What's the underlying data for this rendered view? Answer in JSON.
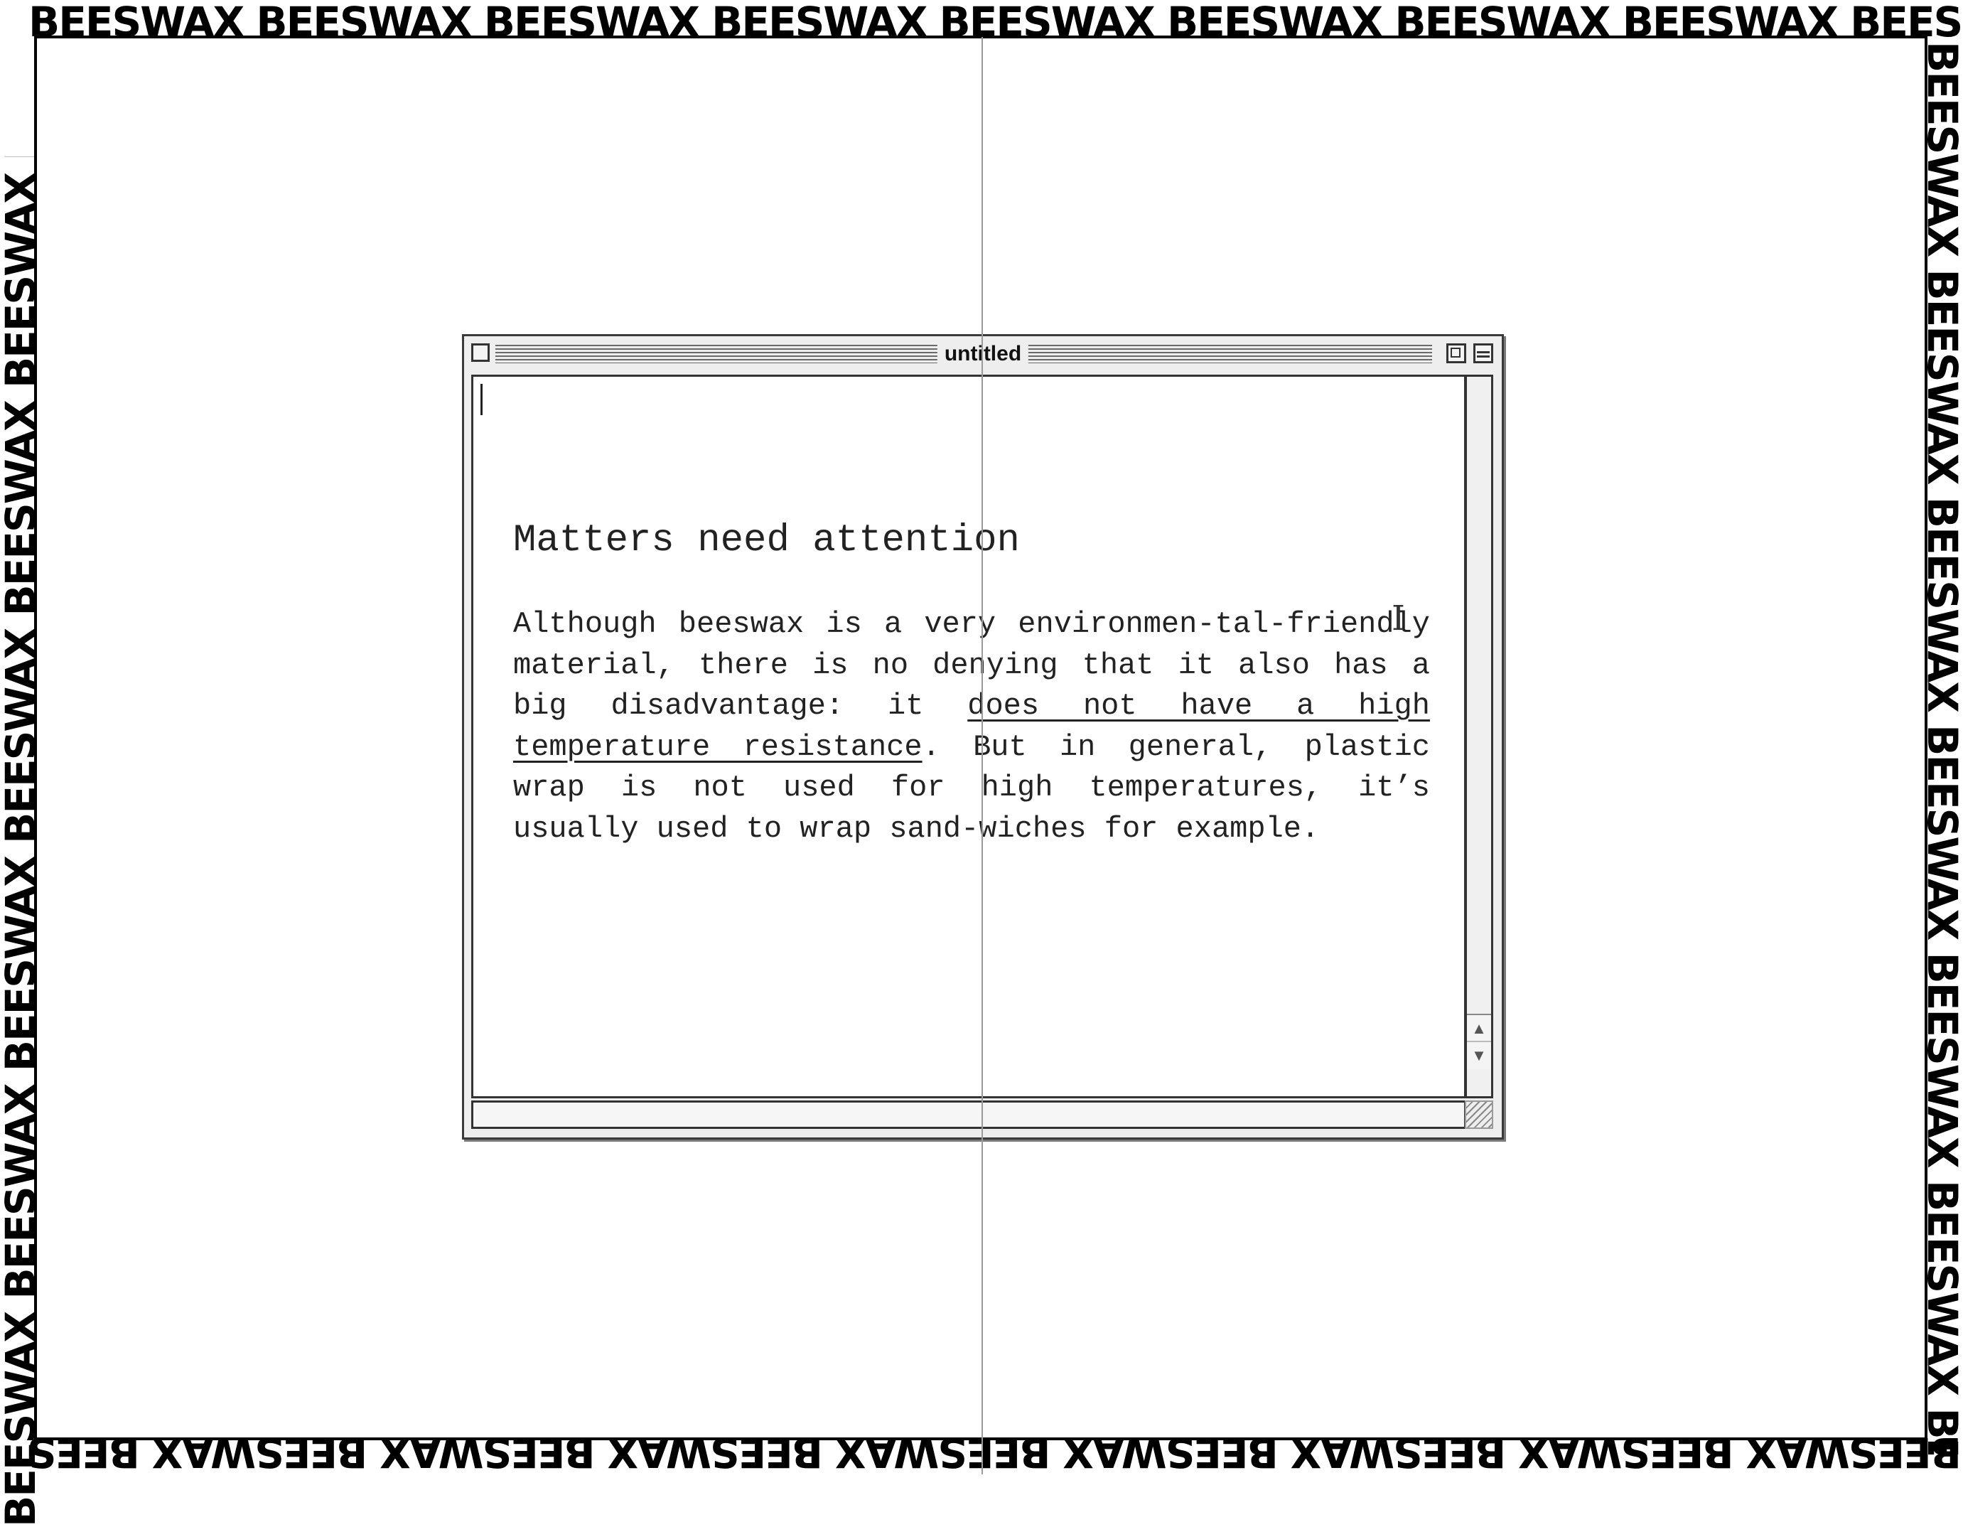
{
  "border": {
    "repeat_text": "BEESWAX BEESWAX BEESWAX BEESWAX BEESWAX BEESWAX BEESWAX BEESWAX BEESWAX BEESWAX BEESWAX BEESWAX"
  },
  "window": {
    "title": "untitled"
  },
  "document": {
    "heading": "Matters need attention",
    "body_before": "Although beeswax is a very environmen-tal-friendly material, there is no denying that it also has a big disadvantage: it ",
    "body_underlined": "does not have a high temperature resistance",
    "body_after": ". But in general, plastic wrap is not used for high temperatures, it’s usually used to wrap sand-wiches for example."
  },
  "icons": {
    "cursor": "text-ibeam-icon",
    "scroll_up": "scroll-up-arrow-icon",
    "scroll_down": "scroll-down-arrow-icon"
  },
  "colors": {
    "background": "#ffffff",
    "border_text": "#000000",
    "window_chrome": "#eeeeee",
    "guide_line": "#9a9a9a"
  }
}
